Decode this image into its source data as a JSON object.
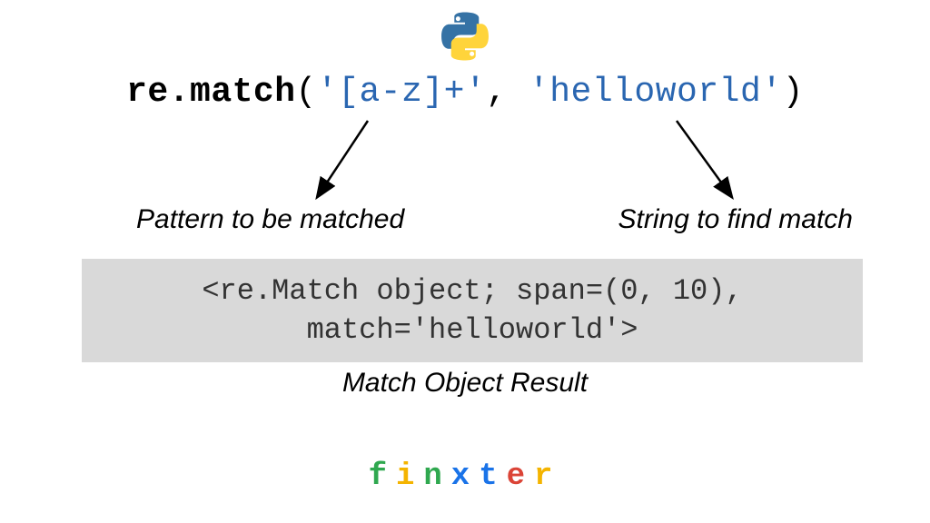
{
  "code": {
    "function": "re.match",
    "open_paren": "(",
    "arg1": "'[a-z]+'",
    "comma": ", ",
    "arg2": "'helloworld'",
    "close_paren": ")"
  },
  "labels": {
    "pattern": "Pattern to be matched",
    "string": "String to find match",
    "result_caption": "Match Object Result"
  },
  "output": {
    "line1": "<re.Match object; span=(0, 10),",
    "line2": "match='helloworld'>"
  },
  "brand": {
    "letters": [
      "f",
      "i",
      "n",
      "x",
      "t",
      "e",
      "r"
    ],
    "colors": [
      "#2fa84f",
      "#f4b400",
      "#2fa84f",
      "#1a73e8",
      "#1a73e8",
      "#db4437",
      "#f4b400"
    ]
  },
  "icon": {
    "python_blue": "#3572A5",
    "python_yellow": "#FFD43B"
  }
}
